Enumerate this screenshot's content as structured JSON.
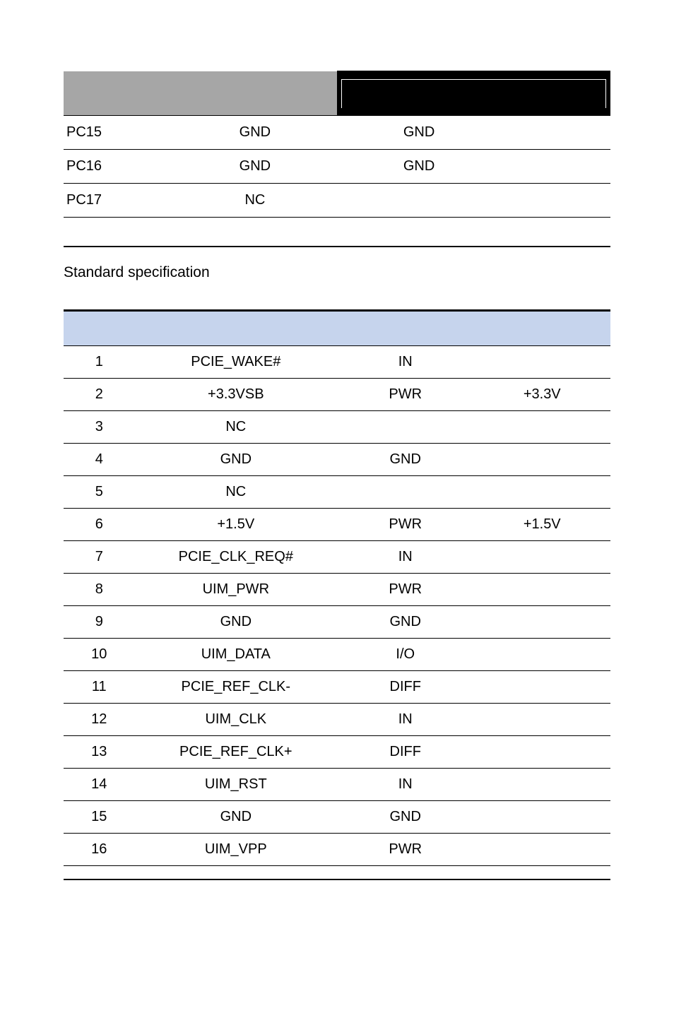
{
  "table1": {
    "rows": [
      {
        "c1": "PC15",
        "c2": "GND",
        "c3": "GND",
        "c4": ""
      },
      {
        "c1": "PC16",
        "c2": "GND",
        "c3": "GND",
        "c4": ""
      },
      {
        "c1": "PC17",
        "c2": "NC",
        "c3": "",
        "c4": ""
      }
    ]
  },
  "section_title": "Standard specification",
  "table2": {
    "rows": [
      {
        "pin": "1",
        "signal": "PCIE_WAKE#",
        "type": "IN",
        "volt": ""
      },
      {
        "pin": "2",
        "signal": "+3.3VSB",
        "type": "PWR",
        "volt": "+3.3V"
      },
      {
        "pin": "3",
        "signal": "NC",
        "type": "",
        "volt": ""
      },
      {
        "pin": "4",
        "signal": "GND",
        "type": "GND",
        "volt": ""
      },
      {
        "pin": "5",
        "signal": "NC",
        "type": "",
        "volt": ""
      },
      {
        "pin": "6",
        "signal": "+1.5V",
        "type": "PWR",
        "volt": "+1.5V"
      },
      {
        "pin": "7",
        "signal": "PCIE_CLK_REQ#",
        "type": "IN",
        "volt": ""
      },
      {
        "pin": "8",
        "signal": "UIM_PWR",
        "type": "PWR",
        "volt": ""
      },
      {
        "pin": "9",
        "signal": "GND",
        "type": "GND",
        "volt": ""
      },
      {
        "pin": "10",
        "signal": "UIM_DATA",
        "type": "I/O",
        "volt": ""
      },
      {
        "pin": "11",
        "signal": "PCIE_REF_CLK-",
        "type": "DIFF",
        "volt": ""
      },
      {
        "pin": "12",
        "signal": "UIM_CLK",
        "type": "IN",
        "volt": ""
      },
      {
        "pin": "13",
        "signal": "PCIE_REF_CLK+",
        "type": "DIFF",
        "volt": ""
      },
      {
        "pin": "14",
        "signal": "UIM_RST",
        "type": "IN",
        "volt": ""
      },
      {
        "pin": "15",
        "signal": "GND",
        "type": "GND",
        "volt": ""
      },
      {
        "pin": "16",
        "signal": "UIM_VPP",
        "type": "PWR",
        "volt": ""
      }
    ]
  }
}
